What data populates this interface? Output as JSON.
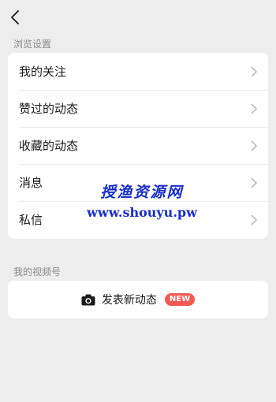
{
  "header": {
    "back_icon": "chevron-left-icon"
  },
  "browse_section": {
    "title": "浏览设置",
    "items": [
      {
        "label": "我的关注"
      },
      {
        "label": "赞过的动态"
      },
      {
        "label": "收藏的动态"
      },
      {
        "label": "消息"
      },
      {
        "label": "私信"
      }
    ]
  },
  "video_section": {
    "title": "我的视频号",
    "post_button_label": "发表新动态",
    "post_button_icon": "camera-icon",
    "badge": "NEW"
  },
  "watermark": {
    "line1": "授渔资源网",
    "line2": "www.shouyu.pw"
  },
  "colors": {
    "background": "#ededed",
    "card": "#ffffff",
    "badge": "#f05a53",
    "watermark": "#1a2ec9"
  }
}
